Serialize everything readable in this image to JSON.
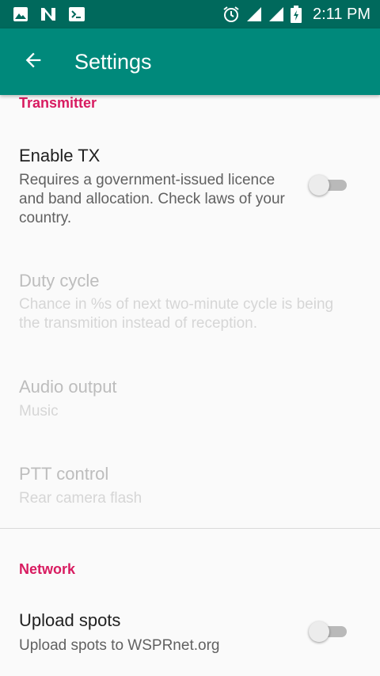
{
  "status_bar": {
    "time": "2:11 PM",
    "left_icons": [
      "image-icon",
      "n-notification-icon",
      "terminal-icon"
    ],
    "right_icons": [
      "alarm-icon",
      "signal-icon",
      "signal-icon",
      "battery-charging-icon"
    ]
  },
  "app_bar": {
    "title": "Settings",
    "back_icon": "arrow-back-icon"
  },
  "sections": {
    "transmitter": {
      "header": "Transmitter",
      "enable_tx": {
        "title": "Enable TX",
        "summary": "Requires a government-issued licence and band allocation. Check laws of your country.",
        "enabled": false
      },
      "duty_cycle": {
        "title": "Duty cycle",
        "summary": "Chance in %s of next two-minute cycle is being the transmition instead of reception."
      },
      "audio_output": {
        "title": "Audio output",
        "summary": "Music"
      },
      "ptt_control": {
        "title": "PTT control",
        "summary": "Rear camera flash"
      }
    },
    "network": {
      "header": "Network",
      "upload_spots": {
        "title": "Upload spots",
        "summary": "Upload spots to WSPRnet.org",
        "enabled": false
      }
    }
  },
  "colors": {
    "status_bar": "#00695c",
    "app_bar": "#00897b",
    "accent": "#d81b60"
  }
}
